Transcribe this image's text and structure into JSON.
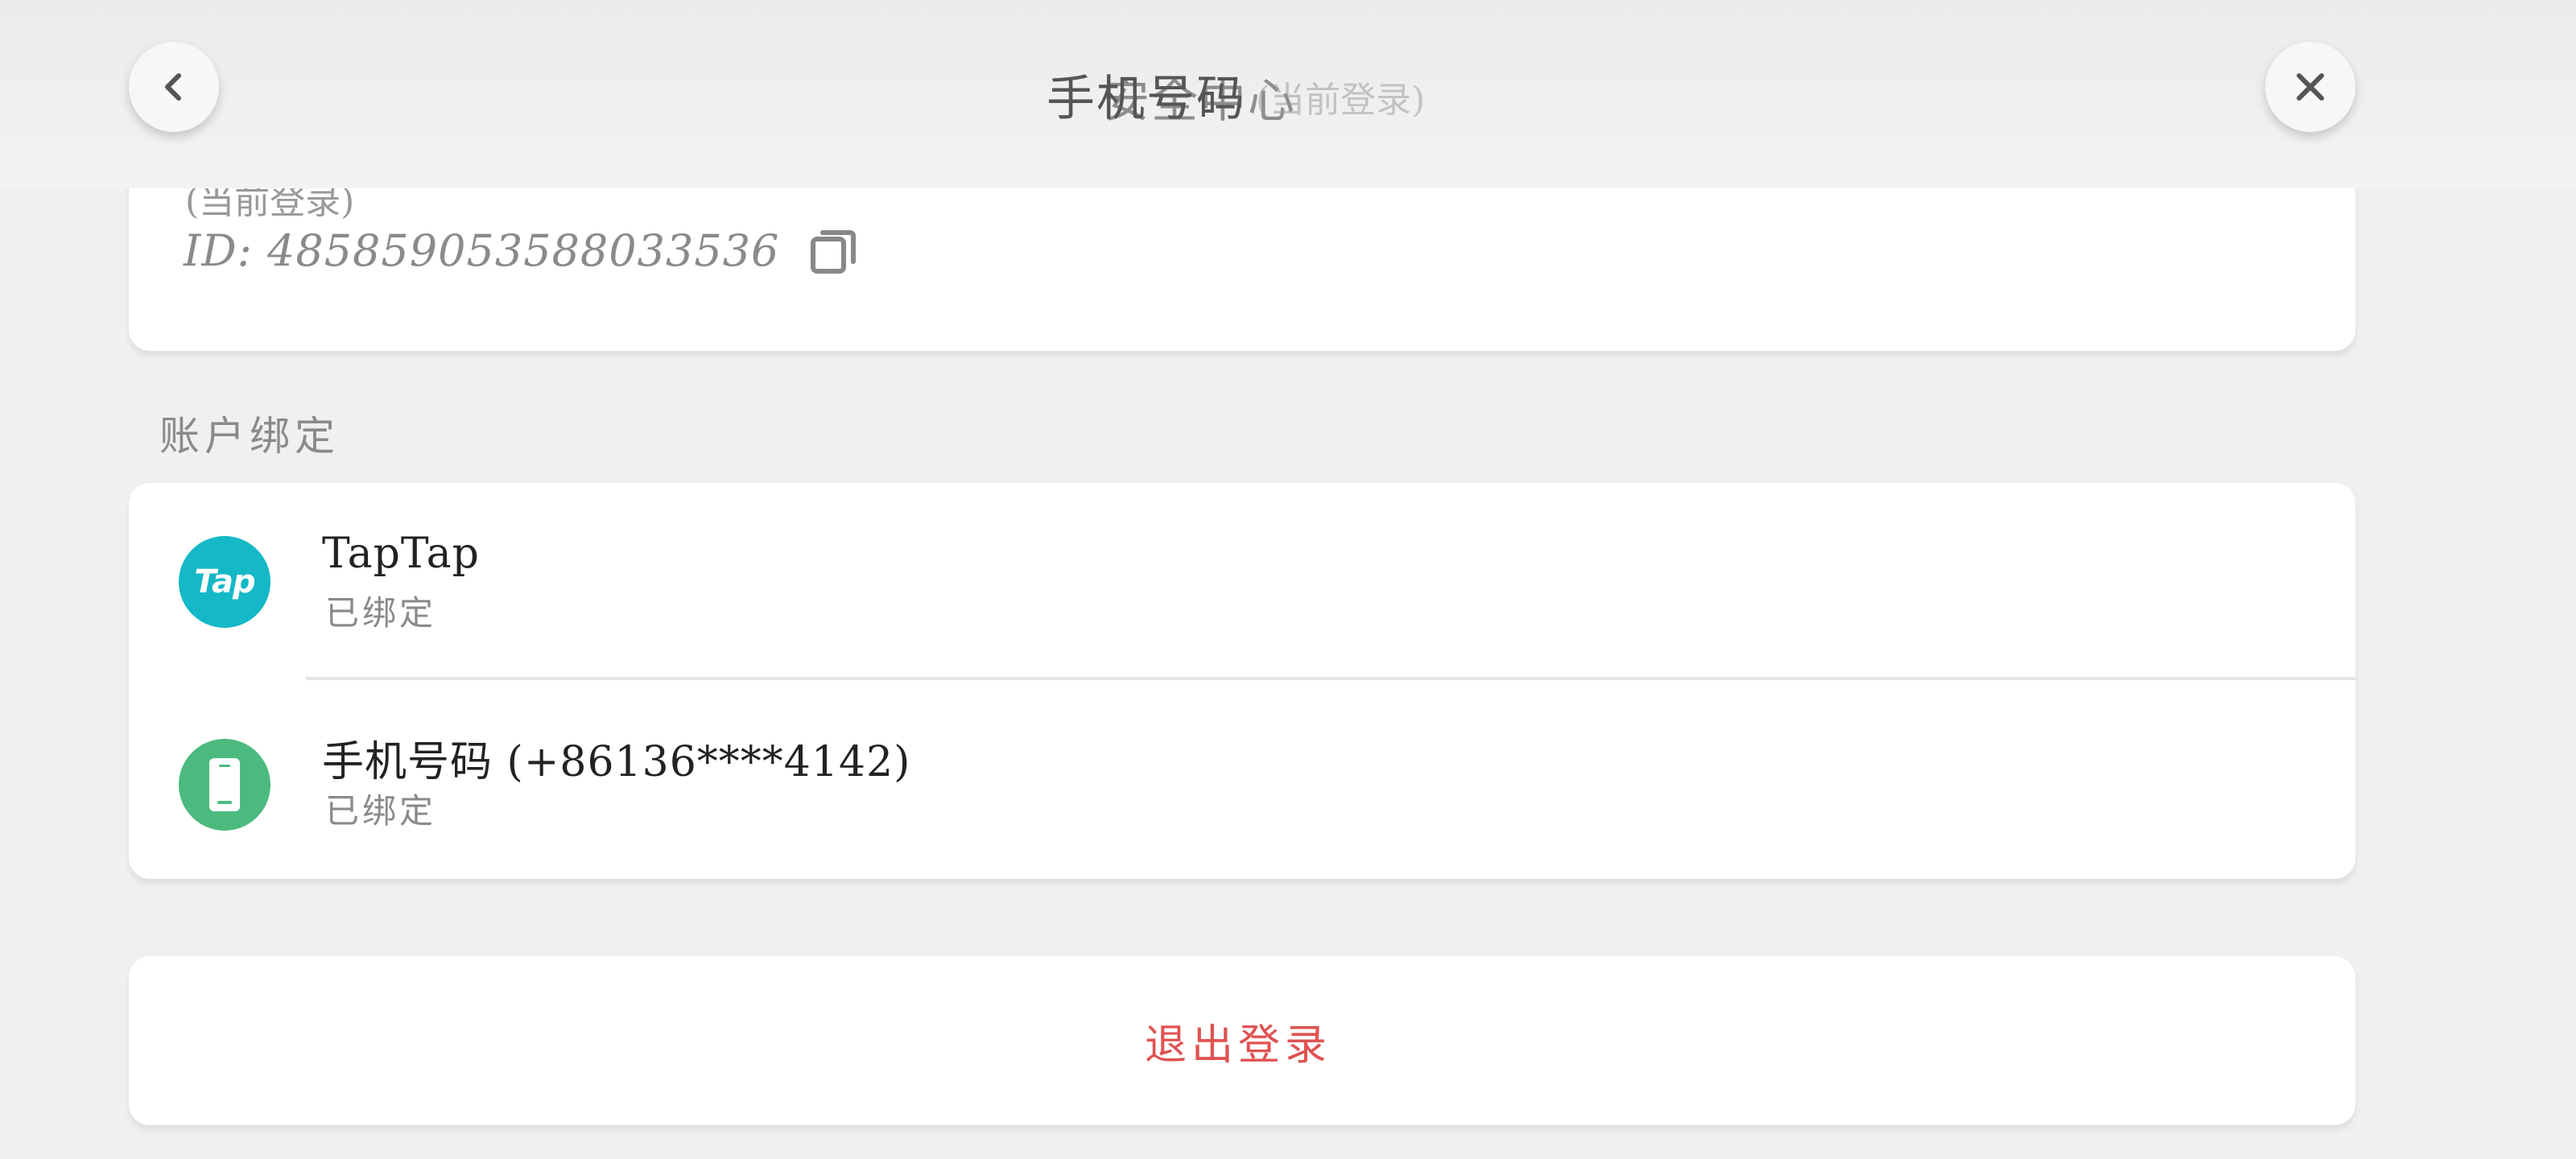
{
  "header": {
    "title": "手机号码",
    "title_ghost": "安全中心",
    "subtitle_ghost": "(当前登录)",
    "back_icon": "chevron-left-icon",
    "close_icon": "close-icon"
  },
  "profile": {
    "partial_text": "(当前登录)",
    "id_text": "ID: 485859053588033536",
    "copy_icon": "copy-icon"
  },
  "account_binding": {
    "section_title": "账户绑定",
    "items": [
      {
        "name": "TapTap",
        "status": "已绑定",
        "logo_text": "Tap",
        "logo_color": "#14b8c7"
      },
      {
        "name": "手机号码 (+86136****4142)",
        "status": "已绑定",
        "logo_icon": "phone-icon",
        "logo_color": "#4cba7e"
      }
    ]
  },
  "logout": {
    "label": "退出登录",
    "color": "#e05252"
  }
}
